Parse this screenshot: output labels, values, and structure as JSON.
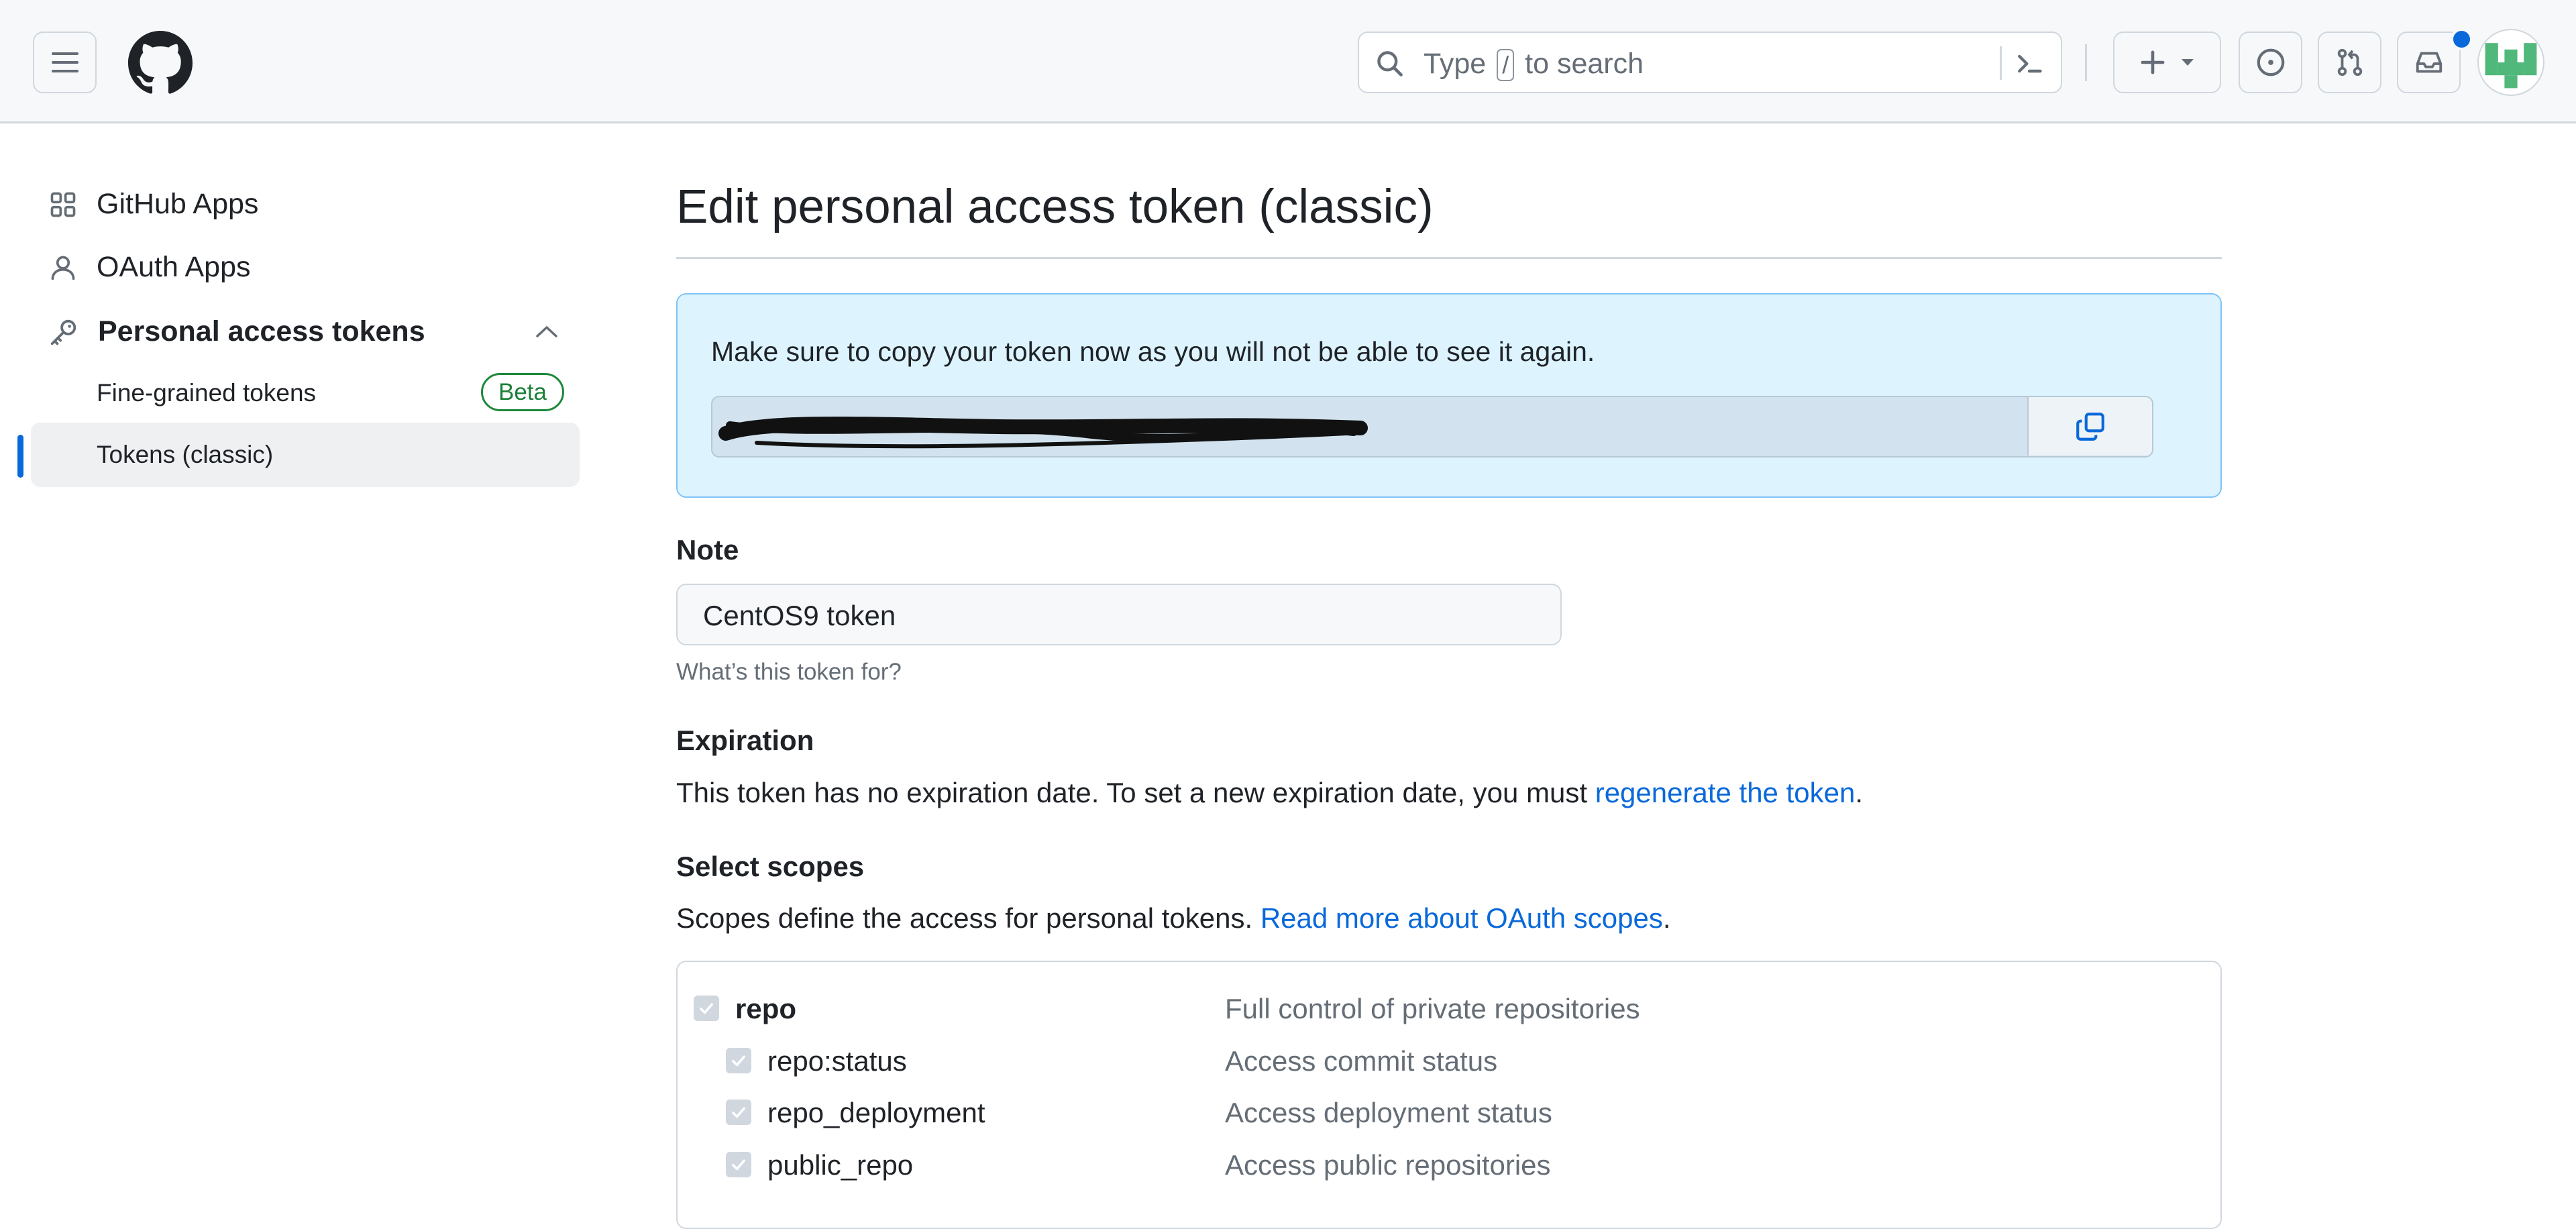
{
  "header": {
    "search_placeholder_pre": "Type",
    "search_key": "/",
    "search_placeholder_post": "to search"
  },
  "sidebar": {
    "items": [
      {
        "label": "GitHub Apps",
        "icon": "apps-icon"
      },
      {
        "label": "OAuth Apps",
        "icon": "person-icon"
      },
      {
        "label": "Personal access tokens",
        "icon": "key-icon"
      }
    ],
    "subitems": [
      {
        "label": "Fine-grained tokens",
        "badge": "Beta"
      },
      {
        "label": "Tokens (classic)",
        "active": true
      }
    ]
  },
  "main": {
    "title": "Edit personal access token (classic)",
    "flash_message": "Make sure to copy your token now as you will not be able to see it again.",
    "note": {
      "label": "Note",
      "value": "CentOS9 token",
      "hint": "What’s this token for?"
    },
    "expiration": {
      "label": "Expiration",
      "text": "This token has no expiration date. To set a new expiration date, you must ",
      "link": "regenerate the token",
      "suffix": "."
    },
    "scopes": {
      "label": "Select scopes",
      "text": "Scopes define the access for personal tokens. ",
      "link": "Read more about OAuth scopes",
      "suffix": ".",
      "rows": [
        {
          "name": "repo",
          "desc": "Full control of private repositories",
          "checked": true
        },
        {
          "name": "repo:status",
          "desc": "Access commit status",
          "checked": true
        },
        {
          "name": "repo_deployment",
          "desc": "Access deployment status",
          "checked": true
        },
        {
          "name": "public_repo",
          "desc": "Access public repositories",
          "checked": true
        }
      ]
    }
  },
  "colors": {
    "accent": "#0969da",
    "flash_bg": "#ddf4ff",
    "beta_green": "#1a7f37",
    "notification_dot": "#0969da"
  }
}
